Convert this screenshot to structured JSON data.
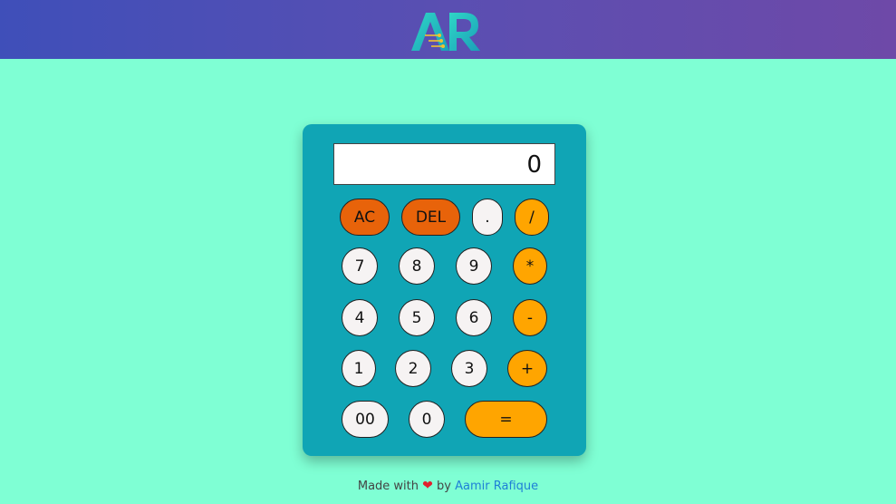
{
  "header": {
    "logo_text": "AR"
  },
  "calculator": {
    "display_value": "0",
    "buttons": {
      "ac": "AC",
      "del": "DEL",
      "dot": ".",
      "divide": "/",
      "seven": "7",
      "eight": "8",
      "nine": "9",
      "multiply": "*",
      "four": "4",
      "five": "5",
      "six": "6",
      "minus": "-",
      "one": "1",
      "two": "2",
      "three": "3",
      "plus": "+",
      "double_zero": "00",
      "zero": "0",
      "equals": "="
    }
  },
  "footer": {
    "made_with": "Made with",
    "heart": "❤",
    "by": "by",
    "author": "Aamir Rafique"
  },
  "colors": {
    "page_bg": "#7fffd4",
    "calc_bg": "#10a5b5",
    "operator": "#ffa500",
    "action": "#e8630a",
    "number": "#f6f3f3"
  }
}
